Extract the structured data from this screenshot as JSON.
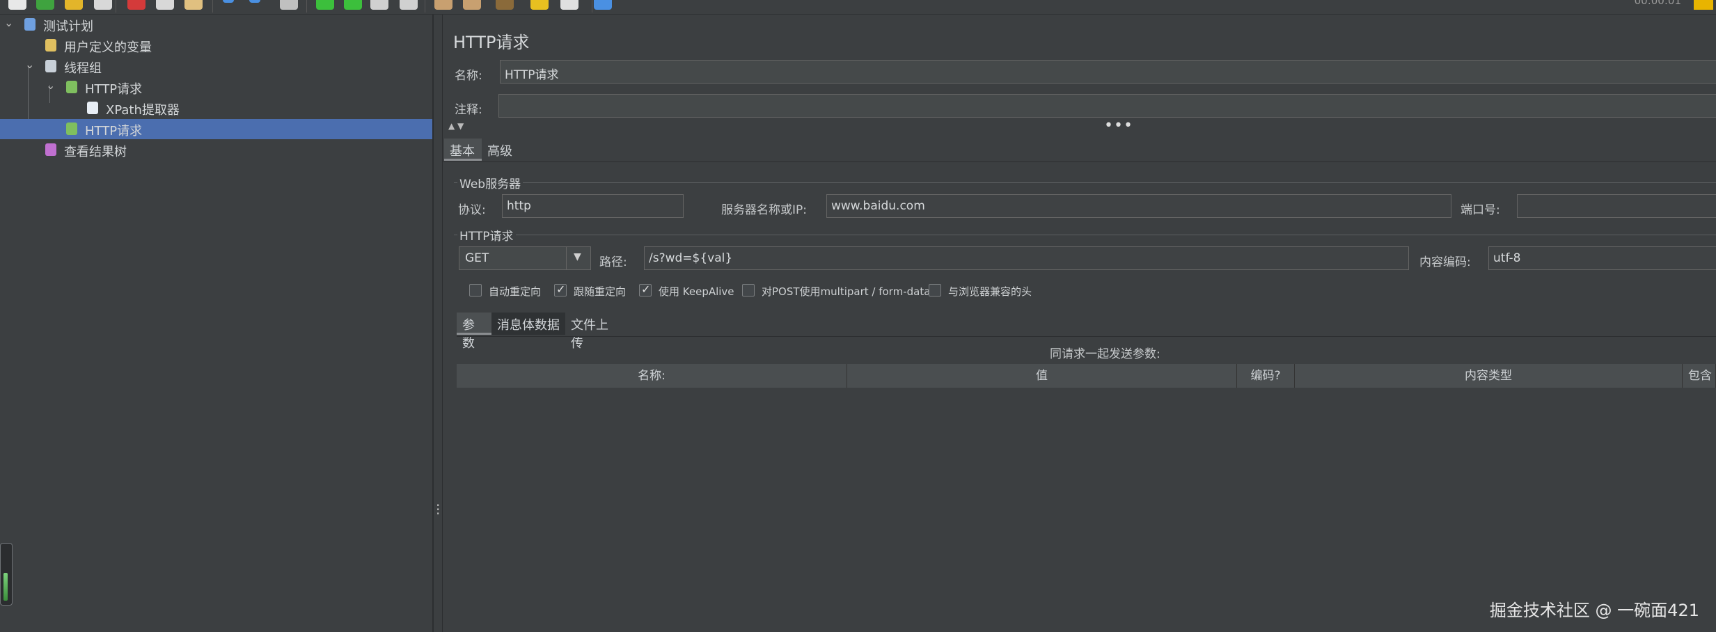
{
  "toolbar": {
    "buttons": [
      {
        "name": "new-icon",
        "color": "#e8e8e8"
      },
      {
        "name": "templates-icon",
        "color": "#3fa33f"
      },
      {
        "name": "open-icon",
        "color": "#e3b52a"
      },
      {
        "name": "save-icon",
        "color": "#d8d8d8"
      },
      {
        "name": "cut-icon",
        "color": "#d43a3a"
      },
      {
        "name": "copy-icon",
        "color": "#d8d8d8"
      },
      {
        "name": "paste-icon",
        "color": "#e0c080"
      },
      {
        "name": "expand-icon",
        "color": "#4a90e2"
      },
      {
        "name": "collapse-icon",
        "color": "#4a90e2"
      },
      {
        "name": "toggle-icon",
        "color": "#c0c0c0"
      },
      {
        "name": "start-icon",
        "color": "#3cbf3c"
      },
      {
        "name": "start-no-pause-icon",
        "color": "#3cbf3c"
      },
      {
        "name": "stop-icon",
        "color": "#d0d0d0"
      },
      {
        "name": "shutdown-icon",
        "color": "#d0d0d0"
      },
      {
        "name": "clear-icon",
        "color": "#c8a070"
      },
      {
        "name": "clear-all-icon",
        "color": "#c8a070"
      },
      {
        "name": "search-icon",
        "color": "#8a6a3a"
      },
      {
        "name": "reset-search-icon",
        "color": "#e8c020"
      },
      {
        "name": "function-helper-icon",
        "color": "#e0e0e0"
      },
      {
        "name": "help-icon",
        "color": "#4a90e2"
      }
    ],
    "timer": "00:00:01"
  },
  "tree": [
    {
      "label": "测试计划",
      "name": "tree-item-test-plan",
      "icon": "flask-icon",
      "level": 0,
      "arrow": "⌄"
    },
    {
      "label": "用户定义的变量",
      "name": "tree-item-user-variables",
      "icon": "tools-icon",
      "level": 1,
      "arrow": ""
    },
    {
      "label": "线程组",
      "name": "tree-item-thread-group",
      "icon": "gear-icon",
      "level": 1,
      "arrow": "⌄"
    },
    {
      "label": "HTTP请求",
      "name": "tree-item-http-request-1",
      "icon": "pipette-icon",
      "level": 2,
      "arrow": "⌄"
    },
    {
      "label": "XPath提取器",
      "name": "tree-item-xpath-extractor",
      "icon": "document-icon",
      "level": 3,
      "arrow": ""
    },
    {
      "label": "HTTP请求",
      "name": "tree-item-http-request-2",
      "icon": "pipette-icon",
      "level": 2,
      "arrow": "",
      "selected": true
    },
    {
      "label": "查看结果树",
      "name": "tree-item-view-results-tree",
      "icon": "chart-icon",
      "level": 1,
      "arrow": ""
    }
  ],
  "panel": {
    "title": "HTTP请求",
    "name_label": "名称:",
    "name_value": "HTTP请求",
    "comment_label": "注释:",
    "comment_value": "",
    "tabs": [
      "基本",
      "高级"
    ],
    "web_server": {
      "group_title": "Web服务器",
      "protocol_label": "协议:",
      "protocol_value": "http",
      "server_label": "服务器名称或IP:",
      "server_value": "www.baidu.com",
      "port_label": "端口号:",
      "port_value": ""
    },
    "http_request": {
      "group_title": "HTTP请求",
      "method": "GET",
      "path_label": "路径:",
      "path_value": "/s?wd=${val}",
      "encoding_label": "内容编码:",
      "encoding_value": "utf-8"
    },
    "options": [
      {
        "label": "自动重定向",
        "checked": false
      },
      {
        "label": "跟随重定向",
        "checked": true
      },
      {
        "label": "使用 KeepAlive",
        "checked": true
      },
      {
        "label": "对POST使用multipart / form-data",
        "checked": false
      },
      {
        "label": "与浏览器兼容的头",
        "checked": false
      }
    ],
    "sub_tabs": [
      "参数",
      "消息体数据",
      "文件上传"
    ],
    "params_caption": "同请求一起发送参数:",
    "columns": [
      "名称:",
      "值",
      "编码?",
      "内容类型",
      "包含"
    ]
  },
  "watermark": "掘金技术社区 @ 一碗面421"
}
